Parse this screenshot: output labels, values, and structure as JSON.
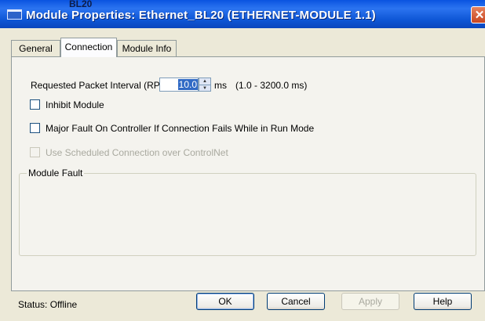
{
  "window": {
    "badge": "BL20",
    "title": "Module Properties: Ethernet_BL20 (ETHERNET-MODULE 1.1)",
    "close_glyph": "✕"
  },
  "tabs": [
    {
      "label": "General",
      "selected": false
    },
    {
      "label": "Connection",
      "selected": true
    },
    {
      "label": "Module Info",
      "selected": false
    }
  ],
  "connection": {
    "rpi_label": "Requested Packet Interval (RPI):",
    "rpi_value": "10.0",
    "rpi_unit": "ms",
    "rpi_range": "(1.0 - 3200.0 ms)",
    "inhibit_label": "Inhibit Module",
    "inhibit_checked": false,
    "major_fault_label": "Major Fault On Controller If Connection Fails While in Run Mode",
    "major_fault_checked": false,
    "scheduled_label": "Use Scheduled Connection over ControlNet",
    "scheduled_checked": false,
    "scheduled_enabled": false
  },
  "module_fault": {
    "legend": "Module Fault"
  },
  "footer": {
    "status_label": "Status:",
    "status_value": "Offline",
    "ok_label": "OK",
    "cancel_label": "Cancel",
    "apply_label": "Apply",
    "help_label": "Help"
  },
  "colors": {
    "titlebar": "#0a54e0",
    "dialog_bg": "#ece9d8",
    "close_button": "#c94620",
    "selection": "#316ac5"
  }
}
